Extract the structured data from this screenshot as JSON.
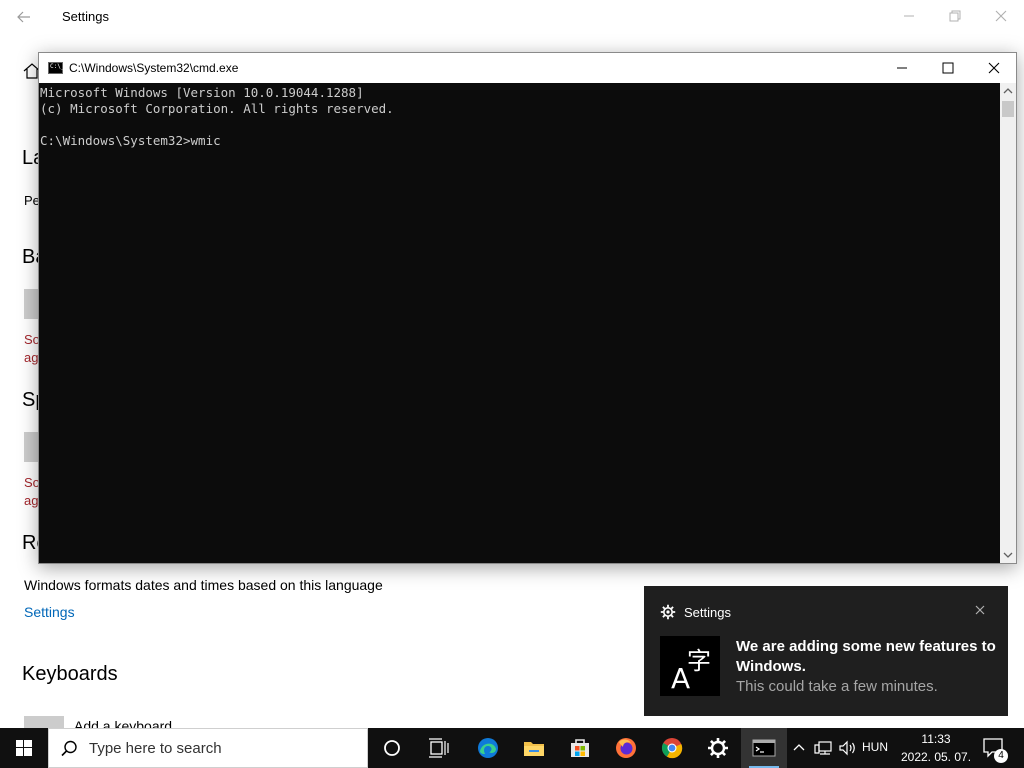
{
  "settings": {
    "title": "Settings",
    "fragments": {
      "language_head": "La",
      "preferred_body": "Pe",
      "basic_head": "Ba",
      "basic_note_1": "So",
      "basic_note_2": "ag",
      "speech_head": "Sp",
      "speech_note_1": "So",
      "speech_note_2": "ag",
      "regional_head": "Re"
    },
    "region_desc": "Windows formats dates and times based on this language",
    "region_link": "Settings",
    "keyboards_heading": "Keyboards",
    "add_keyboard_label": "Add a keyboard"
  },
  "cmd": {
    "title": "C:\\Windows\\System32\\cmd.exe",
    "icon_text": "C:\\_",
    "lines": [
      "Microsoft Windows [Version 10.0.19044.1288]",
      "(c) Microsoft Corporation. All rights reserved.",
      "",
      "C:\\Windows\\System32>wmic"
    ]
  },
  "toast": {
    "app_name": "Settings",
    "heading": "We are adding some new features to Windows.",
    "body": "This could take a few minutes.",
    "image_icon": "language-char-icon"
  },
  "taskbar": {
    "search_placeholder": "Type here to search",
    "apps": [
      "cortana",
      "task-view",
      "edge",
      "file-explorer",
      "microsoft-store",
      "firefox",
      "chrome",
      "settings",
      "cmd"
    ],
    "tray": {
      "language": "HUN",
      "time": "11:33",
      "date": "2022. 05. 07.",
      "notification_count": "4"
    }
  },
  "colors": {
    "console_bg": "#0c0c0c",
    "console_text": "#cccccc",
    "taskbar_bg": "#101010",
    "toast_bg": "#1f1f1f",
    "link": "#0067b8",
    "error_red": "#a4262c"
  }
}
